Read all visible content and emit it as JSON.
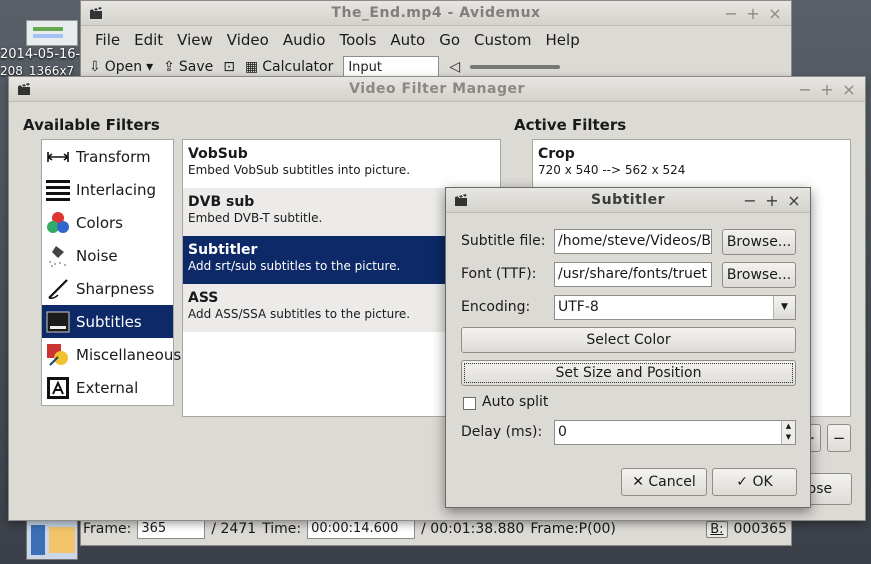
{
  "desktop": {
    "icon_label_line1": "2014-05-16-2",
    "icon_label_line2": "208_1366x7"
  },
  "main_window": {
    "title": "The_End.mp4 - Avidemux",
    "menu": [
      "File",
      "Edit",
      "View",
      "Video",
      "Audio",
      "Tools",
      "Auto",
      "Go",
      "Custom",
      "Help"
    ],
    "toolbar": {
      "open": "Open",
      "save": "Save",
      "calculator": "Calculator",
      "input_combo": "Input"
    },
    "status": {
      "frame_label": "Frame:",
      "frame_value": "365",
      "frame_total": "/ 2471",
      "time_label": "Time:",
      "time_value": "00:00:14.600",
      "time_total": "/ 00:01:38.880",
      "frame_type": "Frame:P(00)",
      "b_button": "B:",
      "b_value": "000365"
    }
  },
  "filter_manager": {
    "title": "Video Filter Manager",
    "available_title": "Available Filters",
    "active_title": "Active Filters",
    "categories": [
      {
        "label": "Transform",
        "icon": "transform-icon"
      },
      {
        "label": "Interlacing",
        "icon": "interlacing-icon"
      },
      {
        "label": "Colors",
        "icon": "colors-icon"
      },
      {
        "label": "Noise",
        "icon": "noise-icon"
      },
      {
        "label": "Sharpness",
        "icon": "sharpness-icon"
      },
      {
        "label": "Subtitles",
        "icon": "subtitles-icon",
        "selected": true
      },
      {
        "label": "Miscellaneous",
        "icon": "miscellaneous-icon"
      },
      {
        "label": "External",
        "icon": "external-icon"
      }
    ],
    "filters": [
      {
        "name": "VobSub",
        "desc": "Embed VobSub subtitles into picture."
      },
      {
        "name": "DVB sub",
        "desc": "Embed DVB-T subtitle."
      },
      {
        "name": "Subtitler",
        "desc": "Add srt/sub subtitles to the picture.",
        "selected": true
      },
      {
        "name": "ASS",
        "desc": "Add ASS/SSA subtitles to the picture."
      }
    ],
    "active_filters": [
      {
        "name": "Crop",
        "desc": "720 x 540 --> 562 x 524"
      }
    ],
    "plus_button": "+",
    "minus_button": "−",
    "close_button": "Close"
  },
  "subtitler": {
    "title": "Subtitler",
    "subtitle_file_label": "Subtitle file:",
    "subtitle_file_value": "/home/steve/Videos/B",
    "font_label": "Font (TTF):",
    "font_value": "/usr/share/fonts/truet",
    "browse": "Browse...",
    "encoding_label": "Encoding:",
    "encoding_value": "UTF-8",
    "select_color": "Select Color",
    "set_size_position": "Set Size and Position",
    "auto_split": "Auto split",
    "delay_label": "Delay (ms):",
    "delay_value": "0",
    "cancel": "Cancel",
    "ok": "OK"
  }
}
